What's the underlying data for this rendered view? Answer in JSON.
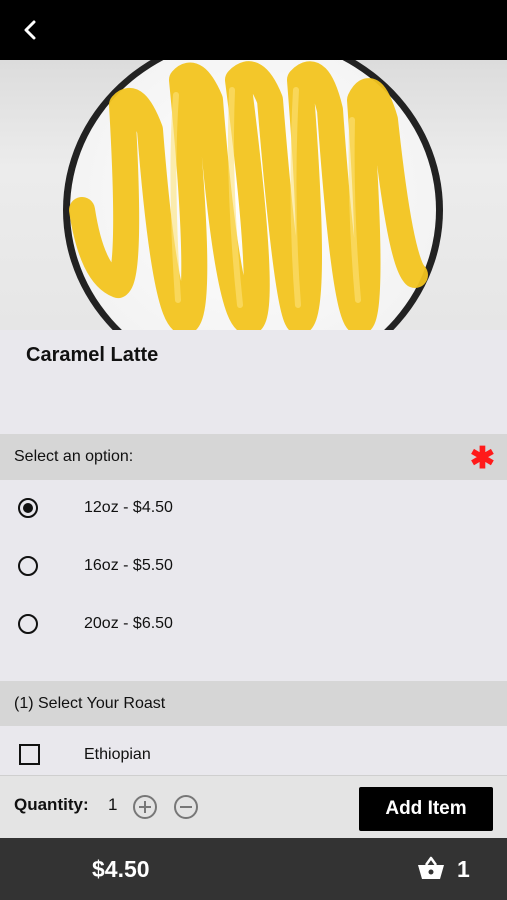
{
  "item": {
    "title": "Caramel Latte"
  },
  "options_section": {
    "header": "Select an option:",
    "required_marker": "✱",
    "options": [
      {
        "label": "12oz - $4.50",
        "selected": true
      },
      {
        "label": "16oz - $5.50",
        "selected": false
      },
      {
        "label": "20oz - $6.50",
        "selected": false
      }
    ]
  },
  "roast_section": {
    "header": "(1) Select Your Roast",
    "choices": [
      {
        "label": "Ethiopian",
        "checked": false
      }
    ]
  },
  "quantity": {
    "label": "Quantity:",
    "value": "1"
  },
  "add_button": {
    "label": "Add Item"
  },
  "footer": {
    "total": "$4.50",
    "cart_count": "1"
  },
  "colors": {
    "top_bar": "#000000",
    "footer": "#333333",
    "required": "#ff1a1a",
    "caramel": "#f2c41f"
  },
  "icons": {
    "back": "chevron-left-icon",
    "add": "plus-circle-icon",
    "remove": "minus-circle-icon",
    "cart": "basket-icon"
  }
}
